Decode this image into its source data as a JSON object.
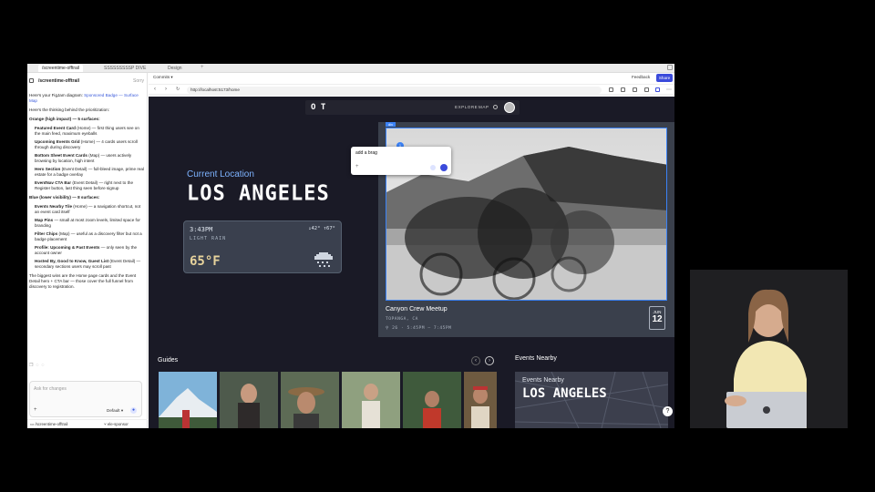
{
  "tabs": [
    {
      "label": "/screentime-offtrail",
      "active": true
    },
    {
      "label": "SSSSSSSSSP DIVE",
      "active": false
    },
    {
      "label": "Design",
      "active": false
    }
  ],
  "chat": {
    "title": "/screentime-offtrail",
    "sorry": "Sorry",
    "intro_prefix": "Here's your FigJam diagram: ",
    "intro_link": "Sponsored Badge — Surface Map",
    "thinking": "Here's the thinking behind the prioritization:",
    "orange_heading": "Orange (high impact) — 5 surfaces:",
    "orange_items": [
      {
        "b": "Featured Event Card",
        "t": " (Home) — first thing users see on the main feed, maximum eyeballs"
      },
      {
        "b": "Upcoming Events Grid",
        "t": " (Home) — 4 cards users scroll through during discovery"
      },
      {
        "b": "Bottom Sheet Event Cards",
        "t": " (Map) — users actively browsing by location, high intent"
      },
      {
        "b": "Hero Section",
        "t": " (Event Detail) — full-bleed image, prime real estate for a badge overlay"
      },
      {
        "b": "EventNav CTA Bar",
        "t": " (Event Detail) — right next to the Register button, last thing seen before signup"
      }
    ],
    "blue_heading": "Blue (lower visibility) — 8 surfaces:",
    "blue_items": [
      {
        "b": "Events Nearby Tile",
        "t": " (Home) — a navigation shortcut, not an event card itself"
      },
      {
        "b": "Map Pins",
        "t": " — small at most zoom levels, limited space for branding"
      },
      {
        "b": "Filter Chips",
        "t": " (Map) — useful as a discovery filter but not a badge placement"
      },
      {
        "b": "Profile: Upcoming & Past Events",
        "t": " — only seen by the account owner"
      },
      {
        "b": "Hosted By, Good to Know, Guest List",
        "t": " (Event Detail) — secondary sections users may scroll past"
      }
    ],
    "conclusion": "The biggest wins are the Home page cards and the Event Detail hero + CTA bar — those cover the full funnel from discovery to registration.",
    "input_placeholder": "Ask for changes",
    "model": "Default",
    "footer_left": "/screentime-offtrail",
    "footer_right": "ele-sponsor"
  },
  "browser": {
    "commits": "Commits",
    "feedback": "Feedback",
    "share": "Share",
    "url": "http://localhost:5173/home"
  },
  "app": {
    "logo": "O T",
    "nav": [
      "EXPLORE",
      "MAP"
    ],
    "current_location_label": "Current Location",
    "city": "LOS ANGELES",
    "weather": {
      "time": "3:43PM",
      "condition": "LIGHT RAIN",
      "hi_lo": "↓42° ↑67°",
      "temp": "65°F"
    },
    "dim_tag": "div",
    "prompt_text": "add a brag",
    "blue_dot": "1",
    "event": {
      "title": "Canyon Crew Meetup",
      "location": "TOPANGA, CA",
      "meta": "⚲ 26 · 5:45PM – 7:45PM",
      "month": "JUN",
      "day": "12"
    },
    "guides_title": "Guides",
    "nearby_title": "Events Nearby",
    "nearby_card_label": "Events Nearby",
    "nearby_card_city": "LOS ANGELES",
    "help": "?"
  },
  "colors": {
    "accent_blue": "#3b82f6",
    "share_button": "#3b4bdb",
    "app_bg": "#1a1a26",
    "location_blue": "#7db3ff"
  }
}
